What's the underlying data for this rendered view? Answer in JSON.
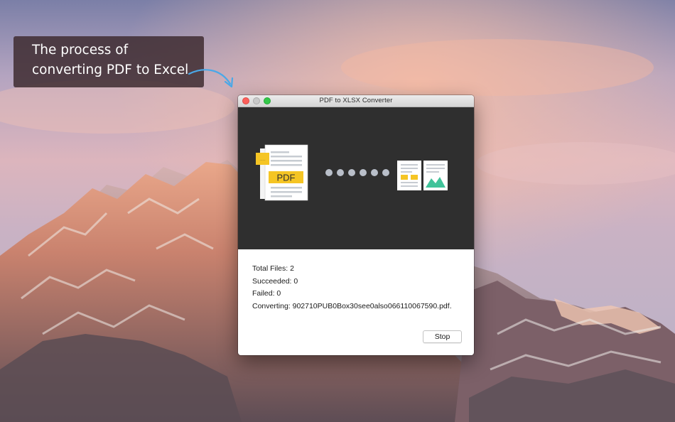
{
  "callout": {
    "line1": "The process of",
    "line2": "converting PDF to Excel"
  },
  "window": {
    "title": "PDF to XLSX Converter"
  },
  "illustration": {
    "source_badge": "PDF",
    "source_tag": "------",
    "progress_dots": 6,
    "accent_color": "#f5c524",
    "chart_color": "#40c39a"
  },
  "stats": {
    "total": "Total Files: 2",
    "succeeded": "Succeeded: 0",
    "failed": "Failed: 0",
    "converting": "Converting: 902710PUB0Box30see0also066110067590.pdf."
  },
  "buttons": {
    "stop_label": "Stop"
  }
}
